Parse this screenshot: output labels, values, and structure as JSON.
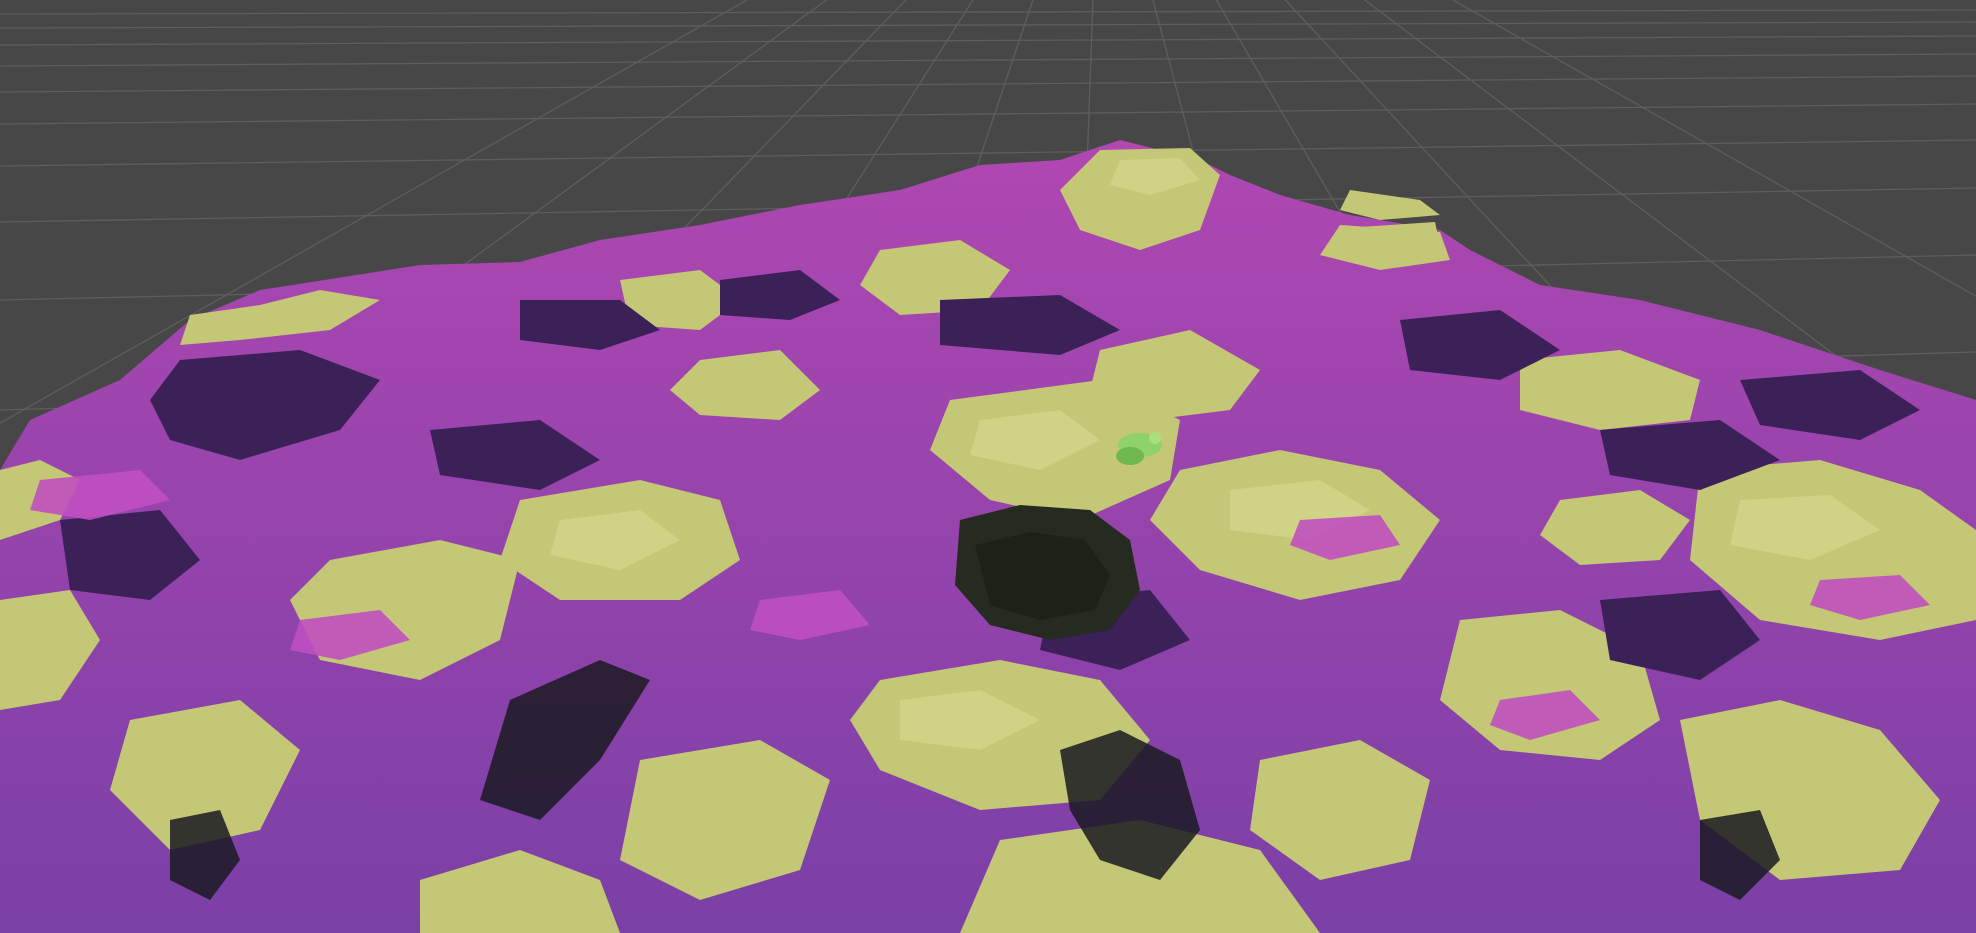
{
  "scene": {
    "kind": "3d-viewport",
    "view": "perspective",
    "grid": true,
    "ground_plane": "checker-grid",
    "terrain_palette": {
      "sky_bg": "#474747",
      "grid_line": "#5e5e5e",
      "lime": "#c4c776",
      "lime_light": "#d2d489",
      "magenta": "#b047b2",
      "purple": "#7a40a6",
      "deep_purple": "#3b2158",
      "shadow": "#1a1a22"
    },
    "objects": [
      "voxel-terrain",
      "green-character"
    ]
  }
}
